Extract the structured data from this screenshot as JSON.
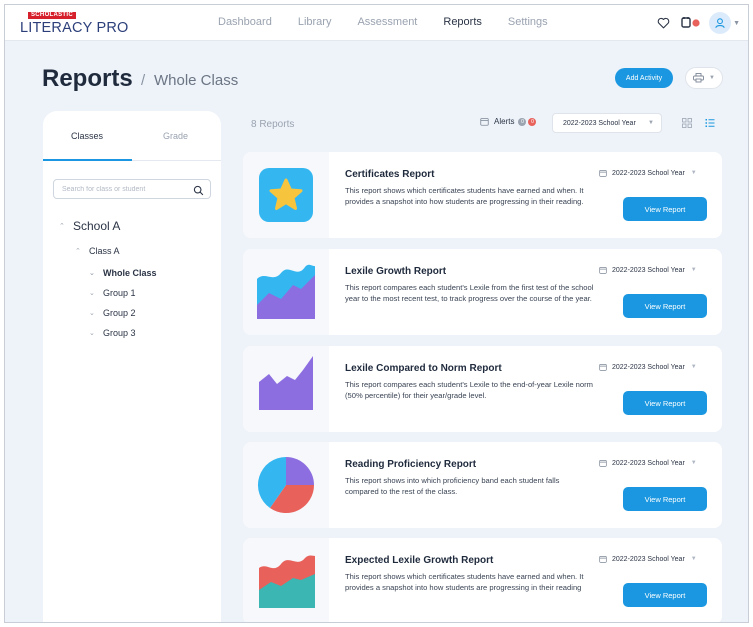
{
  "app": {
    "logo_badge": "SCHOLASTIC",
    "logo_text": "LITERACY PRO"
  },
  "nav": {
    "items": [
      "Dashboard",
      "Library",
      "Assessment",
      "Reports",
      "Settings"
    ],
    "active": "Reports"
  },
  "header": {
    "title": "Reports",
    "separator": "/",
    "breadcrumb": "Whole Class",
    "add_activity_label": "Add Activity"
  },
  "sidebar": {
    "tabs": [
      "Classes",
      "Grade"
    ],
    "active_tab": "Classes",
    "search_placeholder": "Search for class or student",
    "tree": {
      "school": "School A",
      "class": "Class A",
      "groups": [
        "Whole Class",
        "Group 1",
        "Group 2",
        "Group 3"
      ],
      "selected": "Whole Class"
    }
  },
  "toolbar": {
    "report_count": "8 Reports",
    "alerts_label": "Alerts",
    "alerts_badge_1": "0",
    "alerts_badge_2": "0",
    "school_year": "2022-2023 School Year"
  },
  "reports": [
    {
      "title": "Certificates Report",
      "description": "This report shows which certificates students have earned and when. It provides a snapshot into how students are progressing in their reading.",
      "year": "2022-2023 School Year",
      "button": "View Report",
      "icon": "star-icon"
    },
    {
      "title": "Lexile Growth Report",
      "description": "This report compares each student's Lexile from the first test of the school year to the most recent test, to track progress over the course of the year.",
      "year": "2022-2023 School Year",
      "button": "View Report",
      "icon": "growth-chart-icon"
    },
    {
      "title": "Lexile Compared to Norm Report",
      "description": "This report compares each student's Lexile to the end-of-year Lexile norm (50% percentile) for their year/grade level.",
      "year": "2022-2023 School Year",
      "button": "View Report",
      "icon": "area-chart-icon"
    },
    {
      "title": "Reading Proficiency Report",
      "description": "This report shows into which proficiency band each student falls compared to the rest of the class.",
      "year": "2022-2023 School Year",
      "button": "View Report",
      "icon": "pie-chart-icon"
    },
    {
      "title": "Expected Lexile Growth Report",
      "description": "This report shows which certificates students have earned and when. It provides a snapshot into how students are progressing in their reading",
      "year": "2022-2023 School Year",
      "button": "View Report",
      "icon": "expected-growth-icon"
    }
  ],
  "colors": {
    "accent": "#1a97e0",
    "background": "#eef3f9",
    "logo_red": "#d6202c",
    "logo_navy": "#2c3f7a",
    "chart_purple": "#8d6ee0",
    "chart_blue": "#34b7f1",
    "chart_coral": "#e8615b",
    "chart_teal": "#3bb6b2",
    "star_yellow": "#f7c43d"
  }
}
